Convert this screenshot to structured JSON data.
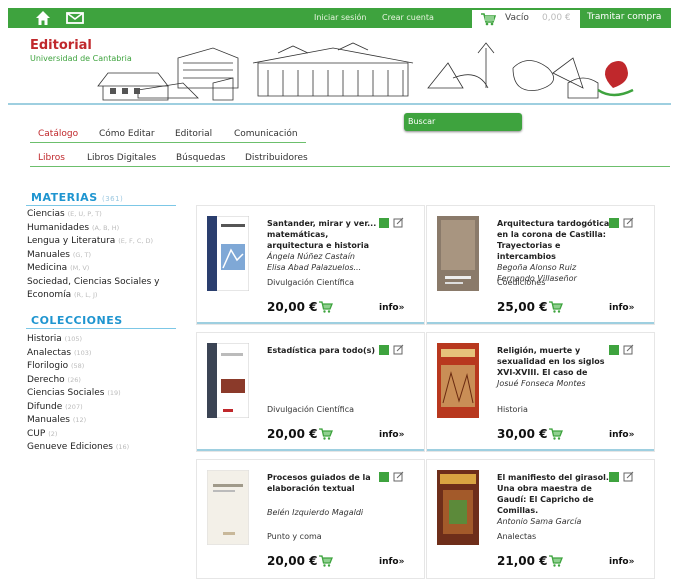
{
  "topbar": {
    "login": "Iniciar sesión",
    "create_account": "Crear cuenta",
    "cart_label": "Vacío",
    "cart_value": "0,00 €",
    "checkout": "Tramitar compra"
  },
  "brand": {
    "name": "Editorial",
    "sub": "Universidad de Cantabria"
  },
  "nav": {
    "main": [
      "Catálogo",
      "Cómo Editar",
      "Editorial",
      "Comunicación"
    ],
    "sub": [
      "Libros",
      "Libros Digitales",
      "Búsquedas",
      "Distribuidores"
    ],
    "search_label": "Buscar"
  },
  "sidebar": {
    "materias_title": "MATERIAS",
    "materias_count": "(361)",
    "materias": [
      {
        "label": "Ciencias",
        "sub": "(E, U, P, T)"
      },
      {
        "label": "Humanidades",
        "sub": "(A, B, H)"
      },
      {
        "label": "Lengua y Literatura",
        "sub": "(E, F, C, D)"
      },
      {
        "label": "Manuales",
        "sub": "(G, T)"
      },
      {
        "label": "Medicina",
        "sub": "(M, V)"
      },
      {
        "label": "Sociedad, Ciencias Sociales y",
        "sub": ""
      },
      {
        "label": "Economía",
        "sub": "(R, L, J)"
      }
    ],
    "colecciones_title": "COLECCIONES",
    "colecciones": [
      {
        "label": "Historia",
        "sub": "(105)"
      },
      {
        "label": "Analectas",
        "sub": "(103)"
      },
      {
        "label": "Florilogio",
        "sub": "(58)"
      },
      {
        "label": "Derecho",
        "sub": "(26)"
      },
      {
        "label": "Ciencias Sociales",
        "sub": "(19)"
      },
      {
        "label": "Difunde",
        "sub": "(207)"
      },
      {
        "label": "Manuales",
        "sub": "(12)"
      },
      {
        "label": "CUP",
        "sub": "(2)"
      },
      {
        "label": "Genueve Ediciones",
        "sub": "(16)"
      }
    ]
  },
  "products": [
    {
      "title": "Santander, mirar y ver... matemáticas, arquitectura e historia",
      "authors": [
        "Ángela Núñez Castaín",
        "Elisa Abad Palazuelos..."
      ],
      "collection": "Divulgación Científica",
      "price": "20,00 €",
      "info": "info»"
    },
    {
      "title": "Arquitectura tardogótica en la corona de Castilla: Trayectorias e intercambios",
      "authors": [
        "Begoña Alonso Ruiz",
        "Fernando Villaseñor"
      ],
      "collection": "Coediciones",
      "price": "25,00 €",
      "info": "info»"
    },
    {
      "title": "Estadística para todo(s)",
      "authors": [],
      "collection": "Divulgación Científica",
      "price": "20,00 €",
      "info": "info»"
    },
    {
      "title": "Religión, muerte y sexualidad en los siglos XVI-XVIII. El caso de",
      "authors": [
        "Josué Fonseca Montes"
      ],
      "collection": "Historia",
      "price": "30,00 €",
      "info": "info»"
    },
    {
      "title": "Procesos guiados de la elaboración textual",
      "authors": [
        "Belén Izquierdo Magaldi"
      ],
      "collection": "Punto y coma",
      "price": "20,00 €",
      "info": "info»"
    },
    {
      "title": "El manifiesto del girasol. Una obra maestra de Gaudí: El Capricho de Comillas.",
      "authors": [
        "Antonio Sama García"
      ],
      "collection": "Analectas",
      "price": "21,00 €",
      "info": "info»"
    }
  ],
  "colors": {
    "green": "#3ea33e",
    "red": "#c0282c",
    "blue": "#1f95d0"
  }
}
